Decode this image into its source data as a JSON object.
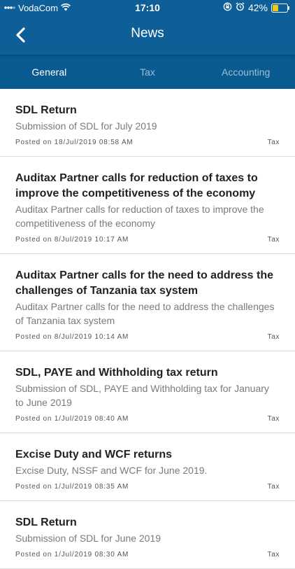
{
  "status_bar": {
    "carrier": "VodaCom",
    "time": "17:10",
    "battery": "42%",
    "battery_level": 0.42,
    "battery_color": "#f5c518"
  },
  "nav": {
    "title": "News",
    "back_icon": "chevron-left-icon"
  },
  "tabs": [
    {
      "label": "General",
      "active": true
    },
    {
      "label": "Tax",
      "active": false
    },
    {
      "label": "Accounting",
      "active": false
    }
  ],
  "colors": {
    "header": "#0e5f97",
    "tabs": "#0a5a92"
  },
  "news": [
    {
      "title": "SDL Return",
      "desc": "Submission of SDL for July 2019",
      "posted": "Posted on 18/Jul/2019 08:58 AM",
      "category": "Tax"
    },
    {
      "title": "Auditax Partner calls for reduction of taxes to improve the competitiveness of the economy",
      "desc": "Auditax Partner calls for reduction of taxes to improve the competitiveness of the economy",
      "posted": "Posted on 8/Jul/2019 10:17 AM",
      "category": "Tax"
    },
    {
      "title": "Auditax Partner calls for the need to address the challenges of Tanzania tax system",
      "desc": "Auditax Partner calls for the need to address the challenges of Tanzania tax system",
      "posted": "Posted on 8/Jul/2019 10:14 AM",
      "category": "Tax"
    },
    {
      "title": "SDL, PAYE and Withholding tax return",
      "desc": "Submission of SDL, PAYE and Withholding tax for January to June 2019",
      "posted": "Posted on 1/Jul/2019 08:40 AM",
      "category": "Tax"
    },
    {
      "title": "Excise Duty and WCF returns",
      "desc": "Excise Duty, NSSF and WCF for June 2019.",
      "posted": "Posted on 1/Jul/2019 08:35 AM",
      "category": "Tax"
    },
    {
      "title": "SDL Return",
      "desc": "Submission of SDL for June 2019",
      "posted": "Posted on 1/Jul/2019 08:30 AM",
      "category": "Tax"
    }
  ]
}
